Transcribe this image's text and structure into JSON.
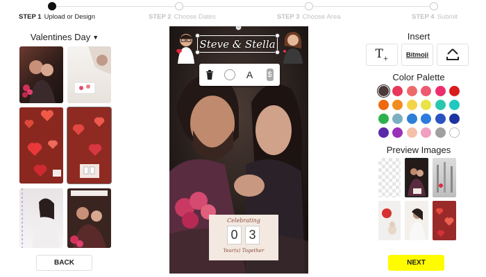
{
  "stepper": {
    "steps": [
      {
        "num": "STEP 1",
        "label": "Upload or Design"
      },
      {
        "num": "STEP 2",
        "label": "Choose Dates"
      },
      {
        "num": "STEP 3",
        "label": "Choose Area"
      },
      {
        "num": "STEP 4",
        "label": "Submit"
      }
    ]
  },
  "left": {
    "theme_select": "Valentines Day",
    "back_label": "BACK"
  },
  "canvas": {
    "top_text": "Steve & Stella",
    "card_line1": "Celebrating",
    "digit1": "0",
    "digit2": "3",
    "card_line2": "Year(s) Together",
    "toolbar": {
      "trash": "trash-icon",
      "circle": "outline-circle-icon",
      "text": "A",
      "dollar": "$"
    }
  },
  "right": {
    "insert_title": "Insert",
    "insert_items": [
      "text-insert-icon",
      "Bitmoji",
      "upload-icon"
    ],
    "palette_title": "Color Palette",
    "palette_colors": [
      "#4a3a3a",
      "#e8375a",
      "#ee6a6a",
      "#ee5872",
      "#ee2d6e",
      "#d91c1c",
      "#ee6a10",
      "#f28c1f",
      "#f5d347",
      "#e8e348",
      "#2ac7b0",
      "#20c9c0",
      "#2db14c",
      "#7bb0c0",
      "#2e7fd8",
      "#2c7bde",
      "#2a52c0",
      "#1c33a0",
      "#5b2aa8",
      "#9a30b8",
      "#f5c0aa",
      "#f0a0c0",
      "#a0a0a0",
      "#ffffff"
    ],
    "preview_title": "Preview Images",
    "next_label": "NEXT"
  }
}
